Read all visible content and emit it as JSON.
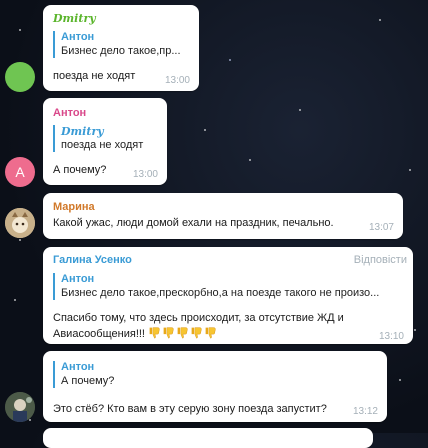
{
  "colors": {
    "link_blue": "#3a9bd5",
    "dmitry_green": "#5bb52c",
    "anton_pink": "#d9488a",
    "marina_orange": "#d1792a",
    "galina_blue": "#3a9bd5",
    "avatar_green": "#6fc552",
    "avatar_pink": "#ee6c8e"
  },
  "messages": [
    {
      "sender": "Dmitry",
      "reply_name": "Антон",
      "reply_text": "Бизнес дело такое,пр...",
      "text": "поезда не ходят",
      "time": "13:00"
    },
    {
      "sender": "Антон",
      "avatar_letter": "A",
      "reply_name": "Dmitry",
      "reply_text": "поезда не ходят",
      "text": "А почему?",
      "time": "13:00"
    },
    {
      "sender": "Марина",
      "text": "Какой ужас, люди домой ехали на праздник, печально.",
      "time": "13:07"
    },
    {
      "sender": "Галина Усенко",
      "reply_action": "Відповісти",
      "reply_name": "Антон",
      "reply_text": "Бизнес дело такое,прескорбно,а на поезде такого не произо...",
      "text_line1": "Спасибо тому, что здесь происходит, за отсутствие ЖД и",
      "text_line2": "Авиасообщения!!!",
      "emoji_name": "thumbs-down-icon",
      "emoji_count": 5,
      "time": "13:10"
    },
    {
      "reply_name": "Антон",
      "reply_text": "А почему?",
      "text": "Это стёб? Кто вам в эту серую зону поезда запустит?",
      "time": "13:12"
    }
  ]
}
